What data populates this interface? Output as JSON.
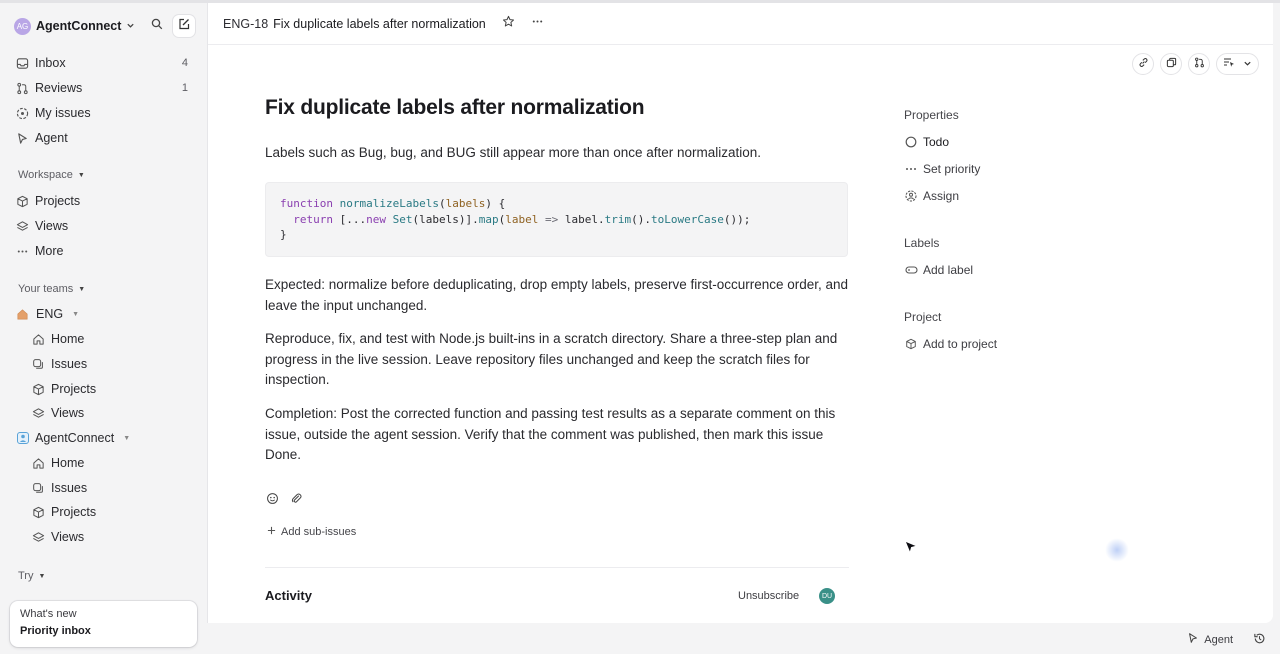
{
  "workspace": {
    "name": "AgentConnect",
    "avatar_initials": "AG"
  },
  "nav": {
    "inbox": {
      "label": "Inbox",
      "count": "4"
    },
    "reviews": {
      "label": "Reviews",
      "count": "1"
    },
    "my_issues": "My issues",
    "agent": "Agent"
  },
  "workspace_section": {
    "heading": "Workspace",
    "projects": "Projects",
    "views": "Views",
    "more": "More"
  },
  "teams": {
    "heading": "Your teams",
    "eng": {
      "name": "ENG",
      "home": "Home",
      "issues": "Issues",
      "projects": "Projects",
      "views": "Views"
    },
    "agentconnect": {
      "name": "AgentConnect",
      "home": "Home",
      "issues": "Issues",
      "projects": "Projects",
      "views": "Views"
    }
  },
  "try_section": {
    "heading": "Try"
  },
  "whats_new": {
    "title": "What's new",
    "item": "Priority inbox"
  },
  "header": {
    "issue_id": "ENG-18",
    "issue_title": "Fix duplicate labels after normalization"
  },
  "issue": {
    "title": "Fix duplicate labels after normalization",
    "description": "Labels such as Bug, bug, and BUG still appear more than once after normalization.",
    "code": {
      "kw_function": "function",
      "fn_name": "normalizeLabels",
      "param": "labels",
      "kw_return": "return",
      "kw_new": "new",
      "cls_set": "Set",
      "fn_map": "map",
      "arrow_param": "label",
      "fn_trim": "trim",
      "fn_lower": "toLowerCase"
    },
    "expected": "Expected: normalize before deduplicating, drop empty labels, preserve first-occurrence order, and leave the input unchanged.",
    "reproduce": "Reproduce, fix, and test with Node.js built-ins in a scratch directory. Share a three-step plan and progress in the live session. Leave repository files unchanged and keep the scratch files for inspection.",
    "completion": "Completion: Post the corrected function and passing test results as a separate comment on this issue, outside the agent session. Verify that the comment was published, then mark this issue Done.",
    "add_sub_issues": "Add sub-issues"
  },
  "activity": {
    "heading": "Activity",
    "unsubscribe": "Unsubscribe",
    "subscriber_initials": "DU"
  },
  "properties": {
    "heading": "Properties",
    "status": "Todo",
    "priority": "Set priority",
    "assignee": "Assign",
    "labels_heading": "Labels",
    "add_label": "Add label",
    "project_heading": "Project",
    "add_to_project": "Add to project"
  },
  "statusbar": {
    "agent_label": "Agent"
  },
  "icons": [
    "chevron-down-icon",
    "search-icon",
    "compose-icon",
    "inbox-icon",
    "pull-request-icon",
    "my-issues-icon",
    "agent-icon",
    "cube-icon",
    "layers-icon",
    "more-icon",
    "home-icon",
    "issues-icon",
    "star-icon",
    "link-icon",
    "copy-icon",
    "branch-icon",
    "status-circle-icon",
    "priority-icon",
    "assign-icon",
    "label-icon",
    "reaction-icon",
    "attach-icon",
    "plus-icon",
    "history-icon",
    "cursor-icon"
  ]
}
